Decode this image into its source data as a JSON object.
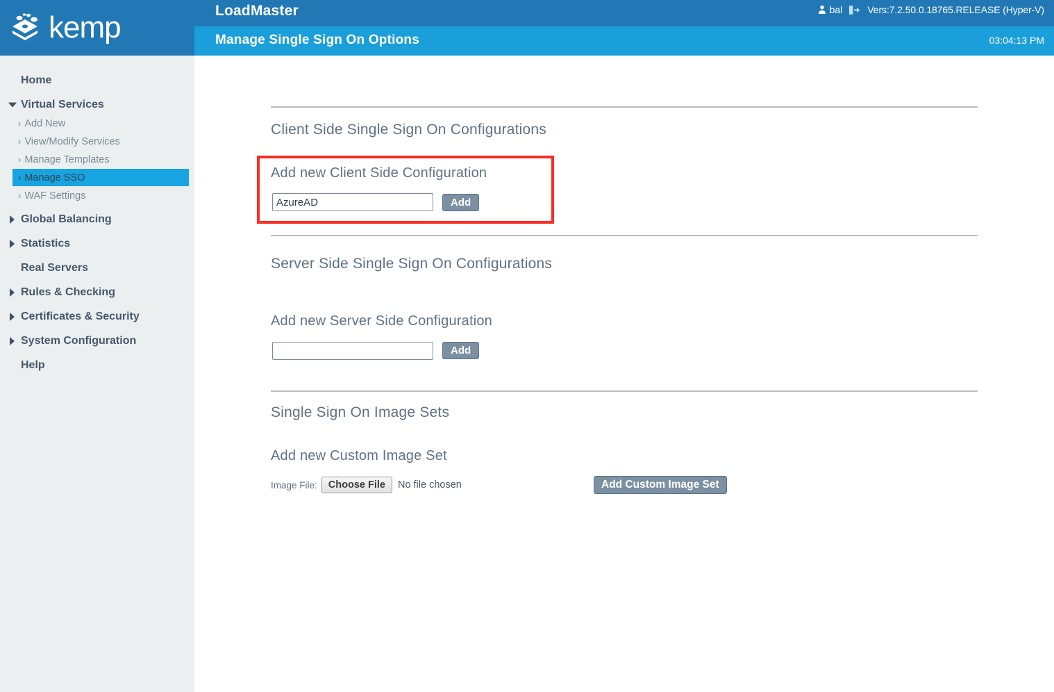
{
  "header": {
    "brand": "kemp",
    "logo_icon": "layers-stack-icon",
    "app_title": "LoadMaster",
    "page_subtitle": "Manage Single Sign On Options",
    "user_icon": "user-icon",
    "user_name": "bal",
    "logout_icon": "logout-icon",
    "version": "Vers:7.2.50.0.18765.RELEASE (Hyper-V)",
    "clock": "03:04:13 PM"
  },
  "sidebar": {
    "items": [
      {
        "label": "Home",
        "type": "top",
        "arrow": "none"
      },
      {
        "label": "Virtual Services",
        "type": "top",
        "arrow": "down"
      },
      {
        "label": "Add New",
        "type": "sub",
        "selected": false
      },
      {
        "label": "View/Modify Services",
        "type": "sub",
        "selected": false
      },
      {
        "label": "Manage Templates",
        "type": "sub",
        "selected": false
      },
      {
        "label": "Manage SSO",
        "type": "sub",
        "selected": true
      },
      {
        "label": "WAF Settings",
        "type": "sub",
        "selected": false
      },
      {
        "label": "Global Balancing",
        "type": "top",
        "arrow": "right"
      },
      {
        "label": "Statistics",
        "type": "top",
        "arrow": "right"
      },
      {
        "label": "Real Servers",
        "type": "top",
        "arrow": "none"
      },
      {
        "label": "Rules & Checking",
        "type": "top",
        "arrow": "right"
      },
      {
        "label": "Certificates & Security",
        "type": "top",
        "arrow": "right"
      },
      {
        "label": "System Configuration",
        "type": "top",
        "arrow": "right"
      },
      {
        "label": "Help",
        "type": "top",
        "arrow": "none"
      }
    ]
  },
  "main": {
    "client_section": {
      "heading": "Client Side Single Sign On Configurations",
      "sub_heading": "Add new Client Side Configuration",
      "input_value": "AzureAD",
      "input_placeholder": "",
      "add_button": "Add"
    },
    "server_section": {
      "heading": "Server Side Single Sign On Configurations",
      "sub_heading": "Add new Server Side Configuration",
      "input_value": "",
      "input_placeholder": "",
      "add_button": "Add"
    },
    "image_section": {
      "heading": "Single Sign On Image Sets",
      "sub_heading": "Add new Custom Image Set",
      "file_label": "Image File:",
      "choose_file_button": "Choose File",
      "no_file_text": "No file chosen",
      "add_image_set_button": "Add Custom Image Set"
    }
  },
  "annotation": {
    "highlight_color": "#fb2c22",
    "highlight_target": "add-new-client-side-configuration"
  },
  "colors": {
    "header_dark_blue": "#2178b5",
    "header_light_blue": "#1a9fdb",
    "sidebar_bg": "#ebeff0",
    "selected_nav": "#18a4e0",
    "button_slate": "#7b90a3",
    "heading_text": "#5f7183"
  }
}
